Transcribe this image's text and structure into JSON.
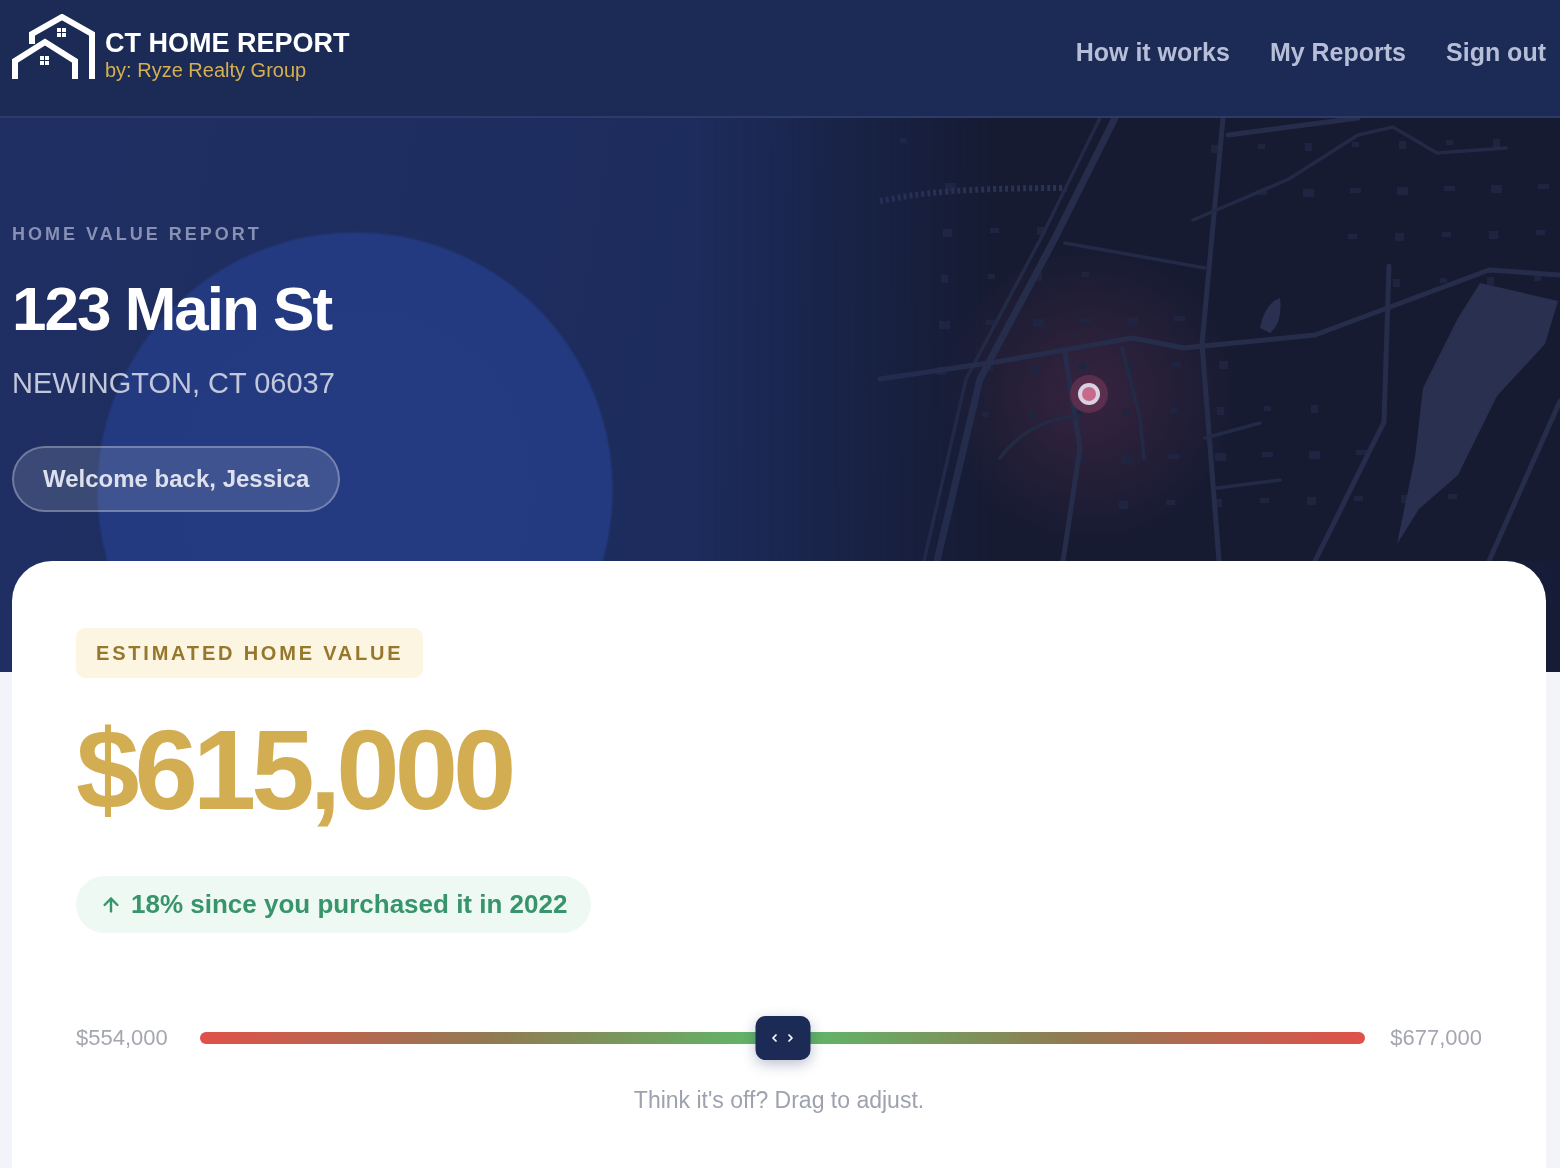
{
  "header": {
    "brand": {
      "title": "CT HOME REPORT",
      "subtitle": "by: Ryze Realty Group"
    },
    "nav": [
      "How it works",
      "My Reports",
      "Sign out"
    ]
  },
  "hero": {
    "eyebrow": "HOME VALUE REPORT",
    "address": "123 Main St",
    "city": "NEWINGTON, CT 06037",
    "greeting": "Welcome back, Jessica"
  },
  "estimate": {
    "badge": "ESTIMATED HOME VALUE",
    "value": "$615,000",
    "change": {
      "rising": true,
      "text": "18% since you purchased it in 2022"
    },
    "range": {
      "min": "$554,000",
      "max": "$677,000",
      "level": 0.5,
      "hint": "Think it's off? Drag to adjust."
    }
  }
}
